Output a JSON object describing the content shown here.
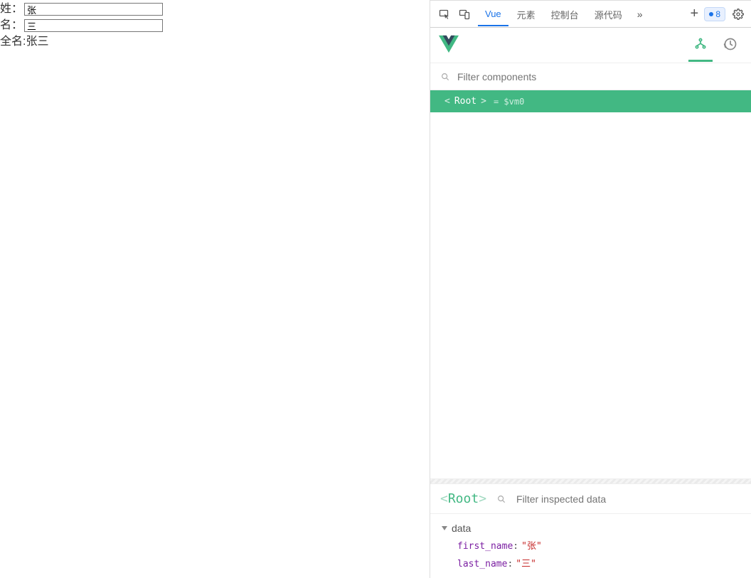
{
  "page": {
    "labels": {
      "lastname": "姓：",
      "firstname": "名：",
      "fullname": "全名:"
    },
    "values": {
      "lastname": "张",
      "firstname": "三",
      "fullname": "张三"
    }
  },
  "devtools": {
    "tabs": {
      "vue": "Vue",
      "elements": "元素",
      "console": "控制台",
      "sources": "源代码"
    },
    "badge_count": "8"
  },
  "vuePanel": {
    "filterComponentsPlaceholder": "Filter components",
    "tree": {
      "rootLabel": "Root",
      "varAssign": "= $vm0"
    },
    "inspect": {
      "rootLabel": "Root",
      "filterPlaceholder": "Filter inspected data"
    },
    "data": {
      "sectionTitle": "data",
      "items": [
        {
          "key": "first_name",
          "value": "张"
        },
        {
          "key": "last_name",
          "value": "三"
        }
      ]
    }
  }
}
